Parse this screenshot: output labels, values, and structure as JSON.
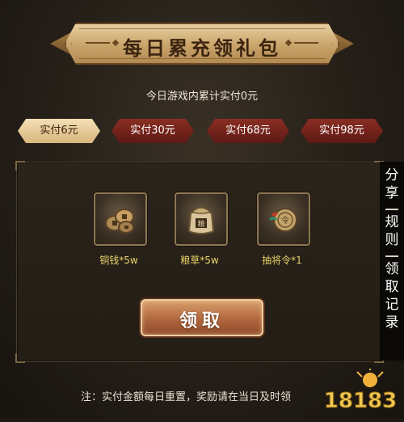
{
  "header": {
    "title": "每日累充领礼包"
  },
  "summary": {
    "text": "今日游戏内累计实付0元"
  },
  "tabs": [
    {
      "label": "实付6元",
      "active": true
    },
    {
      "label": "实付30元",
      "active": false
    },
    {
      "label": "实付68元",
      "active": false
    },
    {
      "label": "实付98元",
      "active": false
    }
  ],
  "rewards": [
    {
      "icon": "copper-coins-icon",
      "label": "铜钱*5w"
    },
    {
      "icon": "grain-sack-icon",
      "label": "粮草*5w"
    },
    {
      "icon": "recruit-token-icon",
      "label": "抽将令*1"
    }
  ],
  "claim": {
    "label": "领取"
  },
  "side_menu": {
    "items": [
      "分享",
      "规则",
      "领取记录"
    ]
  },
  "footer": {
    "note": "注：实付金额每日重置，奖励请在当日及时领"
  },
  "watermark": {
    "text": "18183"
  },
  "colors": {
    "accent_gold": "#e7d36a",
    "tab_active": "#e8c994",
    "tab_normal": "#7a2720"
  }
}
